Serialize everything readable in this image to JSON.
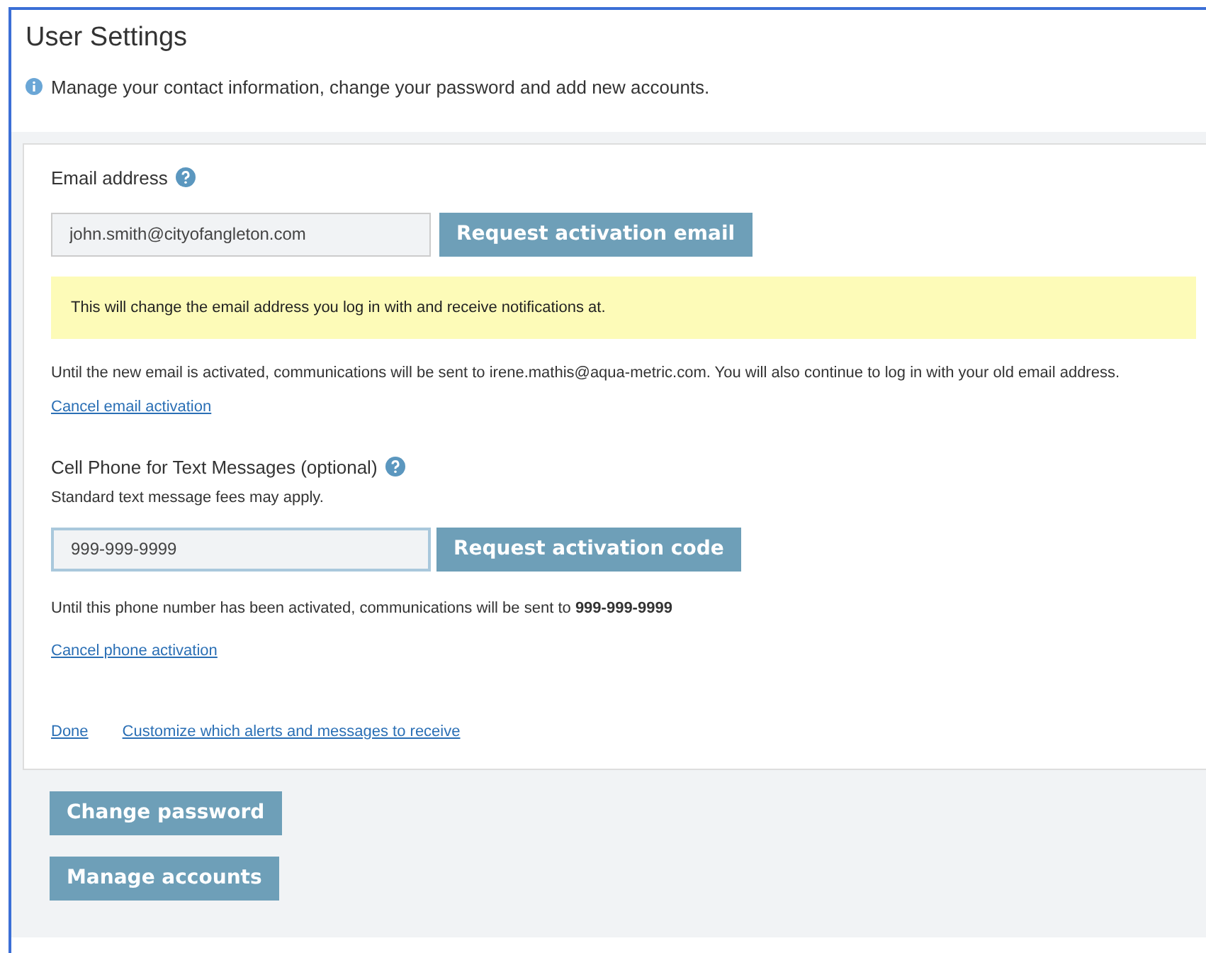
{
  "page": {
    "title": "User Settings",
    "description": "Manage your contact information, change your password and add new accounts."
  },
  "email": {
    "label": "Email address",
    "value": "john.smith@cityofangleton.com",
    "button": "Request activation email",
    "warning": "This will change the email address you log in with and receive notifications at.",
    "note": "Until the new email is activated, communications will be sent to irene.mathis@aqua-metric.com. You will also continue to log in with your old email address.",
    "cancel_link": "Cancel email activation"
  },
  "phone": {
    "label": "Cell Phone for Text Messages (optional)",
    "hint": "Standard text message fees may apply.",
    "value": "999-999-9999",
    "button": "Request activation code",
    "note": "Until this phone number has been activated, communications will be sent to **999-999-9999**",
    "cancel_link": "Cancel phone activation"
  },
  "links": [
    "Done",
    "Customize which alerts and messages to receive"
  ],
  "buttons": [
    "Change password",
    "Manage accounts"
  ]
}
